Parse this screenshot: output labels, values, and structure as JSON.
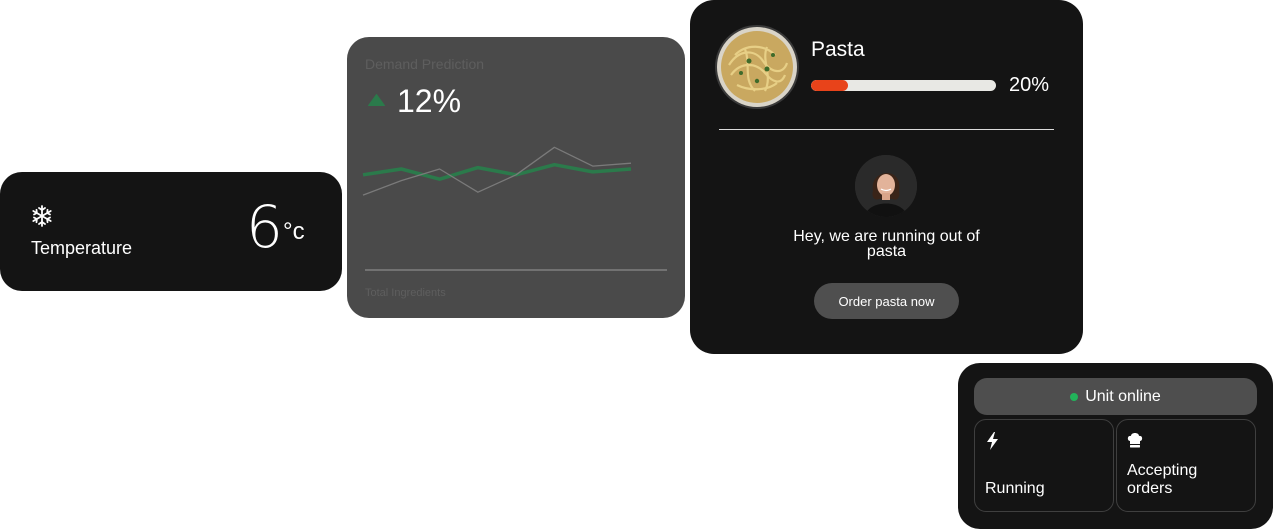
{
  "temperature": {
    "label": "Temperature",
    "value": "6",
    "unit": "°c",
    "icon": "snowflake-icon"
  },
  "demand": {
    "title": "Demand Prediction",
    "change": "12%",
    "trend_icon": "triangle-up-icon",
    "trend_color": "#2b7a4b",
    "footer": "Total Ingredients",
    "chart_data": {
      "type": "line",
      "series": [
        {
          "color": "#2b7a4b",
          "values": [
            36,
            40,
            33,
            41,
            36,
            43,
            38,
            40
          ]
        },
        {
          "color": "#7a7a7a",
          "values": [
            22,
            32,
            40,
            24,
            36,
            55,
            42,
            44
          ]
        }
      ]
    }
  },
  "pasta": {
    "title": "Pasta",
    "level_percent": 20,
    "level_label": "20%",
    "bar_color": "#e8431a",
    "message": "Hey, we are running out of pasta",
    "button_label": "Order pasta now"
  },
  "status": {
    "online_label": "Unit online",
    "online_color": "#22b35a",
    "tiles": [
      {
        "label": "Running",
        "icon": "lightning-icon"
      },
      {
        "label": "Accepting orders",
        "icon": "chef-hat-icon"
      }
    ]
  }
}
